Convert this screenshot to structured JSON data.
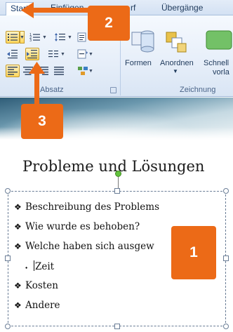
{
  "ribbon": {
    "tabs": [
      {
        "label": "Start",
        "active": true
      },
      {
        "label": "Einfügen",
        "active": false
      },
      {
        "label": "rf",
        "active": false
      },
      {
        "label": "Übergänge",
        "active": false
      }
    ],
    "groups": {
      "absatz": "Absatz",
      "zeichnung": "Zeichnung"
    },
    "buttons": {
      "formen": "Formen",
      "anordnen": "Anordnen",
      "schnell_line1": "Schnell",
      "schnell_line2": "vorla"
    }
  },
  "slide": {
    "title": "Probleme und Lösungen",
    "bullets": [
      {
        "marker": "❖",
        "text": "Beschreibung des Problems",
        "level": 1
      },
      {
        "marker": "❖",
        "text": "Wie wurde es behoben?",
        "level": 1
      },
      {
        "marker": "❖",
        "text": "Welche haben sich ausgew",
        "level": 1
      },
      {
        "marker": "⬩",
        "text": "Zeit",
        "level": 2
      },
      {
        "marker": "❖",
        "text": "Kosten",
        "level": 1
      },
      {
        "marker": "❖",
        "text": "Andere",
        "level": 1
      }
    ]
  },
  "callouts": [
    {
      "number": "1"
    },
    {
      "number": "2"
    },
    {
      "number": "3"
    }
  ],
  "colors": {
    "callout": "#ec6a17",
    "highlight_button": "#ffd75e",
    "rotation_handle": "#62c23c"
  }
}
